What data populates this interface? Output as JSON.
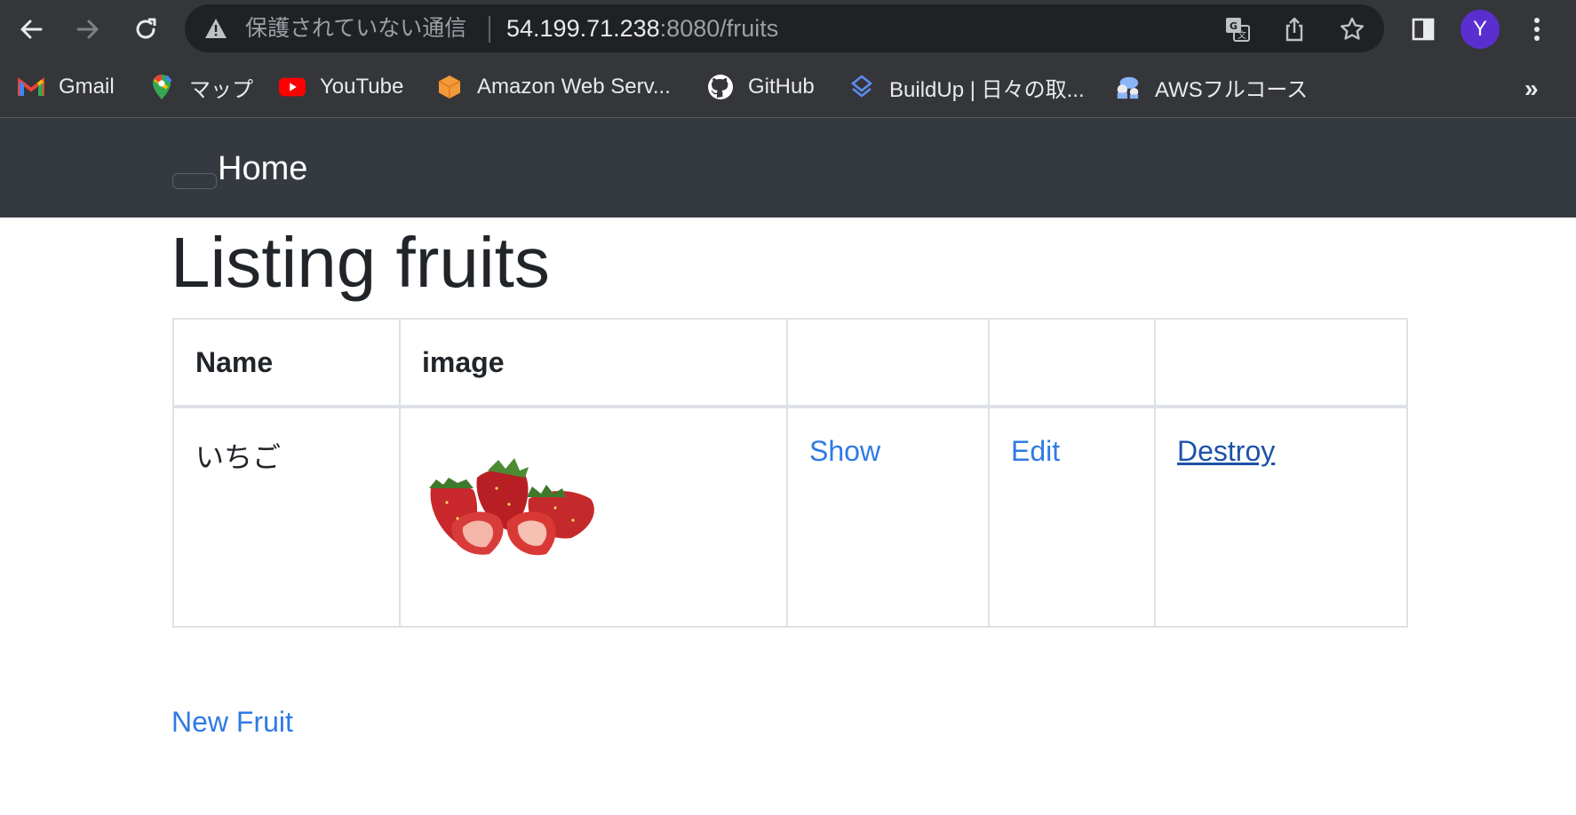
{
  "browser": {
    "security_status": "保護されていない通信",
    "url_host": "54.199.71.238",
    "url_path": ":8080/fruits",
    "profile_initial": "Y",
    "icons": [
      "back-arrow-icon",
      "forward-arrow-icon",
      "reload-icon",
      "warning-icon",
      "translate-icon",
      "share-icon",
      "star-icon",
      "side-panel-icon",
      "kebab-menu-icon"
    ]
  },
  "bookmarks": {
    "items": [
      {
        "label": "Gmail",
        "icon": "gmail-icon"
      },
      {
        "label": "マップ",
        "icon": "maps-icon"
      },
      {
        "label": "YouTube",
        "icon": "youtube-icon"
      },
      {
        "label": "Amazon Web Serv...",
        "icon": "aws-cube-icon"
      },
      {
        "label": "GitHub",
        "icon": "github-icon"
      },
      {
        "label": "BuildUp | 日々の取...",
        "icon": "buildup-icon"
      },
      {
        "label": "AWSフルコース",
        "icon": "aws-course-icon"
      }
    ],
    "more": "»"
  },
  "navbar": {
    "home_label": "Home",
    "background": "#343a40"
  },
  "main": {
    "title": "Listing fruits",
    "table": {
      "headers": [
        "Name",
        "image",
        "",
        "",
        ""
      ],
      "rows": [
        {
          "name": "いちご",
          "image": "strawberries",
          "show": "Show",
          "edit": "Edit",
          "destroy": "Destroy"
        }
      ]
    },
    "new_link": "New Fruit",
    "link_color": "#2f7ae5"
  }
}
